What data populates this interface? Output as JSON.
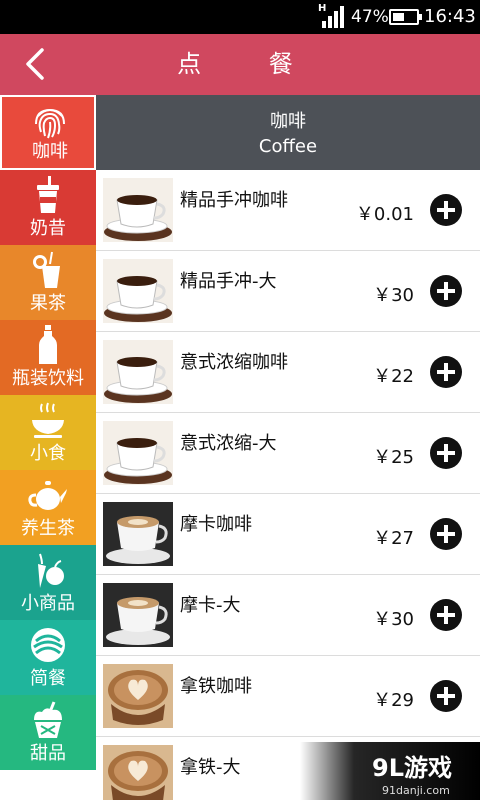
{
  "status_bar": {
    "network": "H",
    "battery": "47%",
    "time": "16:43",
    "icons": [
      "signal-icon",
      "battery-icon"
    ]
  },
  "titlebar": {
    "title": "点 餐",
    "back_icon": "back-chevron-icon"
  },
  "sidebar": {
    "items": [
      {
        "label": "咖啡",
        "icon": "fingerprint-icon",
        "color": "#e84a3c",
        "active": true
      },
      {
        "label": "奶昔",
        "icon": "cup-icon",
        "color": "#d93a34"
      },
      {
        "label": "果茶",
        "icon": "juice-icon",
        "color": "#e8872a"
      },
      {
        "label": "瓶装饮料",
        "icon": "bottle-icon",
        "color": "#e36a24"
      },
      {
        "label": "小食",
        "icon": "snack-icon",
        "color": "#e6b522"
      },
      {
        "label": "养生茶",
        "icon": "teapot-icon",
        "color": "#f2a022"
      },
      {
        "label": "小商品",
        "icon": "produce-icon",
        "color": "#1ba38e"
      },
      {
        "label": "简餐",
        "icon": "meal-icon",
        "color": "#1fb59c"
      },
      {
        "label": "甜品",
        "icon": "dessert-icon",
        "color": "#25b880"
      }
    ]
  },
  "section": {
    "title_cn": "咖啡",
    "title_en": "Coffee"
  },
  "products": [
    {
      "name": "精品手冲咖啡",
      "price": "￥0.01",
      "thumb": "black-coffee"
    },
    {
      "name": "精品手冲-大",
      "price": "￥30",
      "thumb": "black-coffee"
    },
    {
      "name": "意式浓缩咖啡",
      "price": "￥22",
      "thumb": "black-coffee"
    },
    {
      "name": "意式浓缩-大",
      "price": "￥25",
      "thumb": "black-coffee"
    },
    {
      "name": "摩卡咖啡",
      "price": "￥27",
      "thumb": "mocha"
    },
    {
      "name": "摩卡-大",
      "price": "￥30",
      "thumb": "mocha"
    },
    {
      "name": "拿铁咖啡",
      "price": "￥29",
      "thumb": "latte"
    },
    {
      "name": "拿铁-大",
      "price": "",
      "thumb": "latte"
    }
  ],
  "watermark": {
    "brand": "9L游戏",
    "url": "91danji.com"
  }
}
